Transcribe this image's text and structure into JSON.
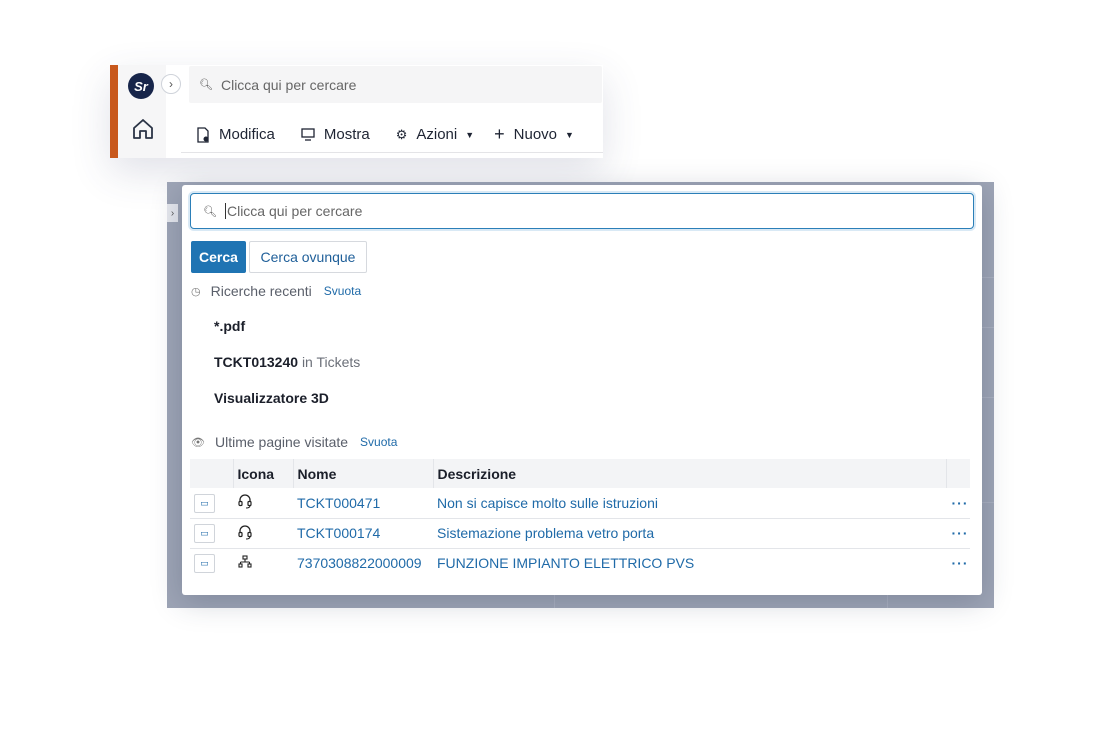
{
  "top_bar": {
    "search_placeholder": "Clicca qui per cercare",
    "toolbar": [
      {
        "label": "Modifica",
        "icon": "document-edit-icon"
      },
      {
        "label": "Mostra",
        "icon": "monitor-icon"
      },
      {
        "label": "Azioni",
        "icon": "gear-icon",
        "has_dropdown": true
      },
      {
        "label": "Nuovo",
        "icon": "plus-icon",
        "has_dropdown": true
      }
    ],
    "accent_color": "#c8581c",
    "logo_color": "#17254a"
  },
  "search_panel": {
    "placeholder": "Clicca qui per cercare",
    "search_button": "Cerca",
    "search_everywhere_button": "Cerca ovunque",
    "recent_searches": {
      "title": "Ricerche recenti",
      "clear": "Svuota",
      "items": [
        {
          "text": "*.pdf",
          "context": ""
        },
        {
          "text": "TCKT013240",
          "context": "in Tickets"
        },
        {
          "text": "Visualizzatore 3D",
          "context": ""
        }
      ]
    },
    "last_visited": {
      "title": "Ultime pagine visitate",
      "clear": "Svuota",
      "columns": [
        "Icona",
        "Nome",
        "Descrizione"
      ],
      "rows": [
        {
          "icon": "headset-icon",
          "name": "TCKT000471",
          "description": "Non si capisce molto sulle istruzioni",
          "actions": "···"
        },
        {
          "icon": "headset-icon",
          "name": "TCKT000174",
          "description": "Sistemazione problema vetro porta",
          "actions": "···"
        },
        {
          "icon": "hierarchy-icon",
          "name": "7370308822000009",
          "description": "FUNZIONE IMPIANTO ELETTRICO PVS",
          "actions": "···"
        }
      ]
    },
    "primary_color": "#1f74b3",
    "link_color": "#1f6aa8"
  }
}
